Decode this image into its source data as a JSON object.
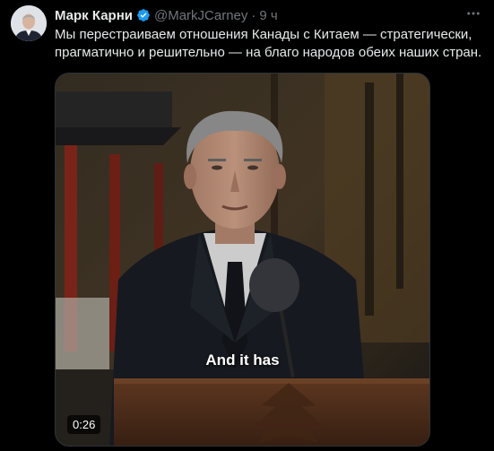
{
  "author": {
    "name": "Марк Карни",
    "handle": "@MarkJCarney",
    "separator": "·",
    "time": "9 ч",
    "verified": true
  },
  "tweet": {
    "text": "Мы перестраиваем отношения Канады с Китаем — стратегически, прагматично и решительно — на благо народов обеих наших стран."
  },
  "video": {
    "caption": "And it has",
    "duration": "0:26"
  },
  "colors": {
    "background": "#000000",
    "text_primary": "#e7e9ea",
    "text_secondary": "#71767b",
    "verified_blue": "#1d9bf0"
  },
  "icons": {
    "verified": "verified-badge-icon",
    "more": "more-icon"
  }
}
